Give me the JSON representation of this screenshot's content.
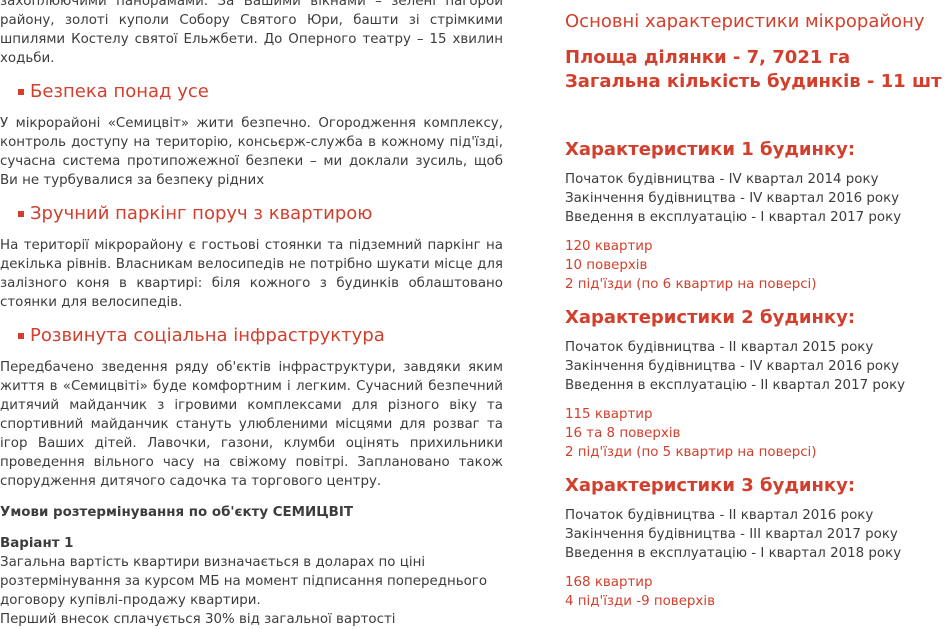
{
  "left": {
    "intro": "захоплюючими панорамами. За Вашими вікнами – зелені пагорби району, золоті куполи Собору Святого Юри, башти зі стрімкими шпилями Костелу святої Ельжбети. До Оперного театру –   15 хвилин ходьби.",
    "sections": [
      {
        "heading": "Безпека понад усе",
        "text": "У мікрорайоні «Семицвіт» жити безпечно. Огородження комплексу, контроль доступу на територію, консьєрж-служба в кожному під'їзді, сучасна система протипожежної безпеки –  ми доклали зусиль, щоб Ви не турбувалися за безпеку рідних"
      },
      {
        "heading": "Зручний паркінг поруч з квартирою",
        "text": "На території мікрорайону є гостьові стоянки та підземний паркінг на декілька рівнів. Власникам велосипедів не потрібно шукати місце для залізного коня в квартирі: біля кожного з будинків облаштовано стоянки для велосипедів."
      },
      {
        "heading": "Розвинута  соціальна  інфраструктура",
        "text": "Передбачено зведення ряду об'єктів інфраструктури, завдяки яким життя в «Семицвіті» буде комфортним і легким. Сучасний безпечний дитячий майданчик з ігровими комплексами для різного віку та спортивний майданчик стануть улюбленими місцями для розваг та ігор Ваших дітей. Лавочки, газони, клумби оцінять прихильники проведення вільного часу на свіжому повітрі. Заплановано також спорудження дитячого садочка та торгового центру."
      }
    ],
    "conditions_title": "Умови розтермінування по об'єкту СЕМИЦВІТ",
    "variant_title": "Варіант 1",
    "variant_text": "Загальна вартість квартири визначається в доларах по ціні розтермінування за курсом МБ на момент підписання попереднього договору купівлі-продажу квартири.",
    "variant_text_cut": "Перший внесок сплачується 30% від загальної вартості"
  },
  "right": {
    "title": "Основні характеристики мікрорайону",
    "area": "Площа ділянки - 7, 7021 га",
    "buildings_total": "Загальна кількість будинків - 11 шт",
    "buildings": [
      {
        "title": "Характеристики 1 будинку:",
        "start": "Початок будівництва - IV квартал 2014 року",
        "finish": "Закінчення будівництва - IV квартал 2016 року",
        "commission": "Введення в експлуатацію - I квартал 2017 року",
        "apartments": "120 квартир",
        "floors": "10 поверхів",
        "entrances": "2 під'їзди (по 6 квартир на поверсі)"
      },
      {
        "title": "Характеристики 2 будинку:",
        "start": "Початок будівництва - II квартал 2015 року",
        "finish": "Закінчення будівництва - IV квартал 2016 року",
        "commission": "Введення в експлуатацію - II квартал 2017 року",
        "apartments": "115 квартир",
        "floors": "16 та 8 поверхів",
        "entrances": "2 під'їзди (по 5 квартир на поверсі)"
      },
      {
        "title": "Характеристики 3 будинку:",
        "start": "Початок будівництва - II квартал 2016 року",
        "finish": "Закінчення будівництва - III квартал 2017 року",
        "commission": "Введення в експлуатацію - I квартал 2018 року",
        "apartments": "168 квартир",
        "floors": "4 під'їзди -9 поверхів"
      }
    ]
  },
  "colors": {
    "accent": "#d23f2c",
    "text": "#3c3c3c"
  }
}
